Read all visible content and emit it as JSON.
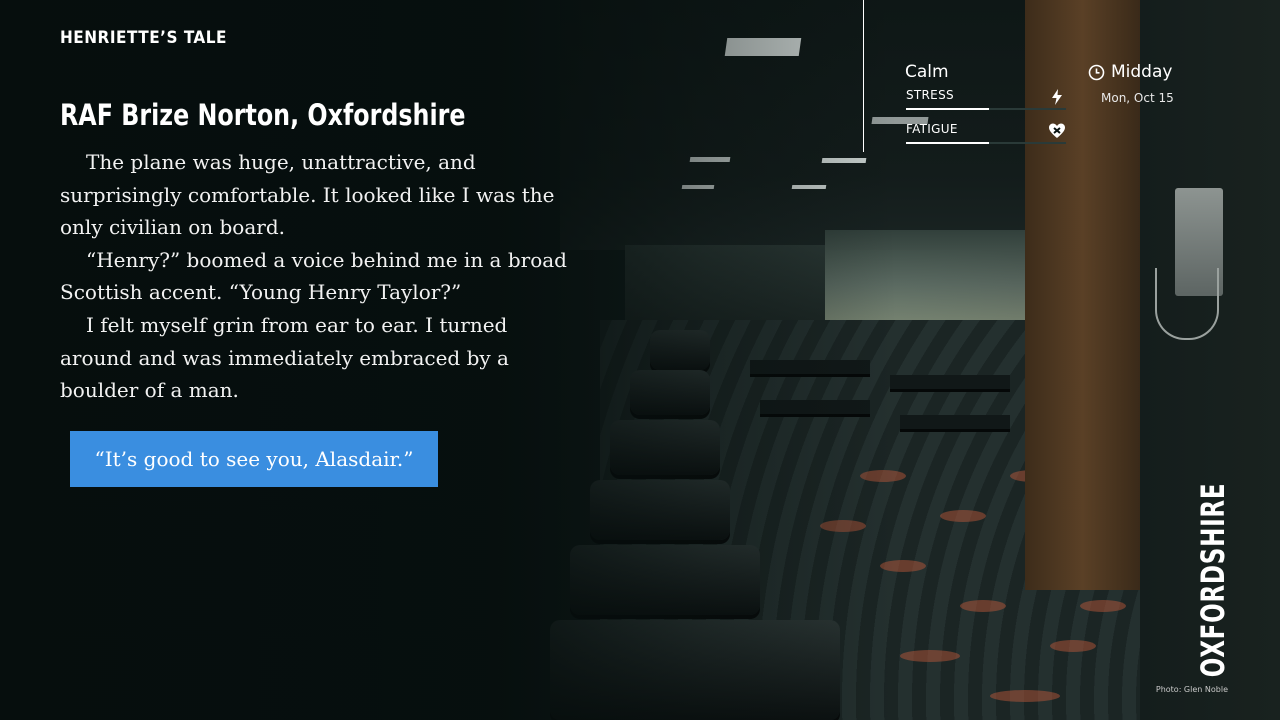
{
  "game": {
    "title": "HENRIETTE’S TALE"
  },
  "scene": {
    "location": "RAF Brize Norton, Oxfordshire",
    "location_vertical": "OXFORDSHIRE",
    "photo_credit": "Photo: Glen Noble"
  },
  "story": {
    "paragraphs": [
      "The plane was huge, unattractive, and surprisingly comfortable. It looked like I was the only civilian on board.",
      "“Henry?” boomed a voice behind me in a broad Scottish accent. “Young Henry Taylor?”",
      "I felt myself grin from ear to ear. I turned around and was immediately embraced by a boulder of a man."
    ]
  },
  "choices": [
    {
      "label": "“It’s good to see you, Alasdair.”",
      "color": "#3a8ee0"
    }
  ],
  "status": {
    "mood": "Calm",
    "stats": [
      {
        "label": "STRESS",
        "level_percent": 52,
        "icon": "lightning-icon"
      },
      {
        "label": "FATIGUE",
        "level_percent": 52,
        "icon": "heart-bandage-icon"
      }
    ],
    "time_of_day": "Midday",
    "time_icon": "clock-icon",
    "date": "Mon, Oct 15"
  }
}
